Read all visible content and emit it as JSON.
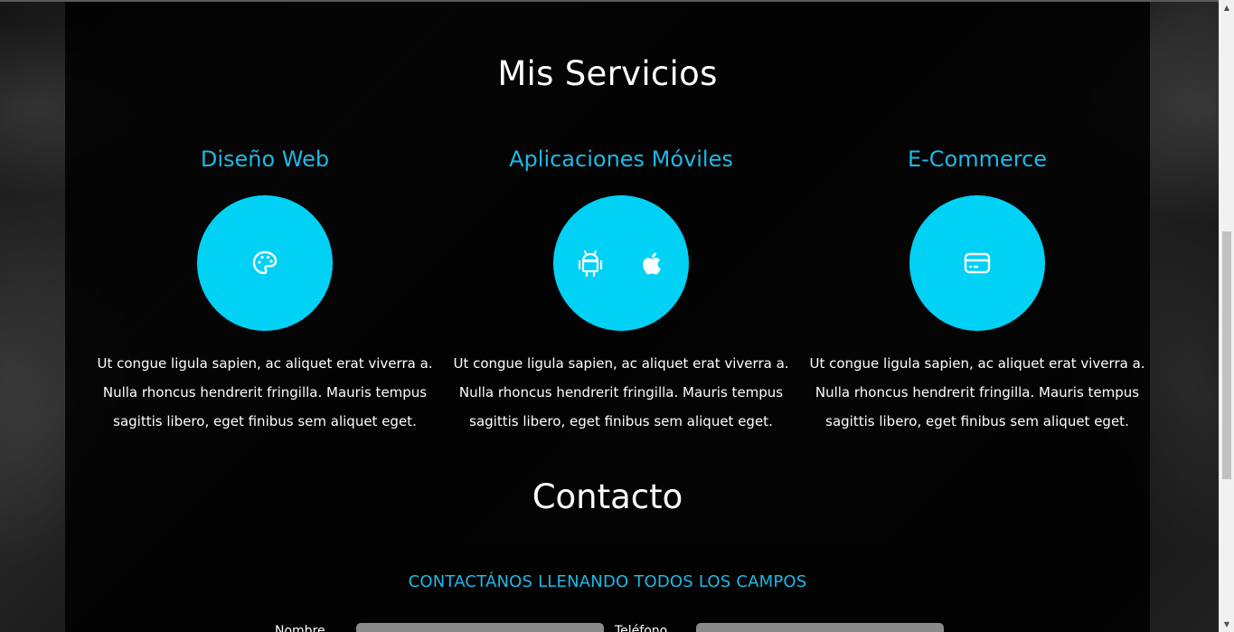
{
  "services_section": {
    "title": "Mis Servicios",
    "items": [
      {
        "name": "Diseño Web",
        "icons": [
          "palette-icon"
        ],
        "description": "Ut congue ligula sapien, ac aliquet erat viverra a. Nulla rhoncus hendrerit fringilla. Mauris tempus sagittis libero, eget finibus sem aliquet eget."
      },
      {
        "name": "Aplicaciones Móviles",
        "icons": [
          "android-icon",
          "apple-icon"
        ],
        "description": "Ut congue ligula sapien, ac aliquet erat viverra a. Nulla rhoncus hendrerit fringilla. Mauris tempus sagittis libero, eget finibus sem aliquet eget."
      },
      {
        "name": "E-Commerce",
        "icons": [
          "credit-card-icon"
        ],
        "description": "Ut congue ligula sapien, ac aliquet erat viverra a. Nulla rhoncus hendrerit fringilla. Mauris tempus sagittis libero, eget finibus sem aliquet eget."
      }
    ]
  },
  "contact_section": {
    "title": "Contacto",
    "form": {
      "heading": "CONTACTÁNOS LLENANDO TODOS LOS CAMPOS",
      "name_label": "Nombre",
      "phone_label": "Teléfono",
      "name_value": "",
      "phone_value": ""
    }
  },
  "colors": {
    "accent": "#1fb8e6",
    "circle": "#00d1f5",
    "panel_bg": "#000000",
    "text": "#ffffff"
  }
}
